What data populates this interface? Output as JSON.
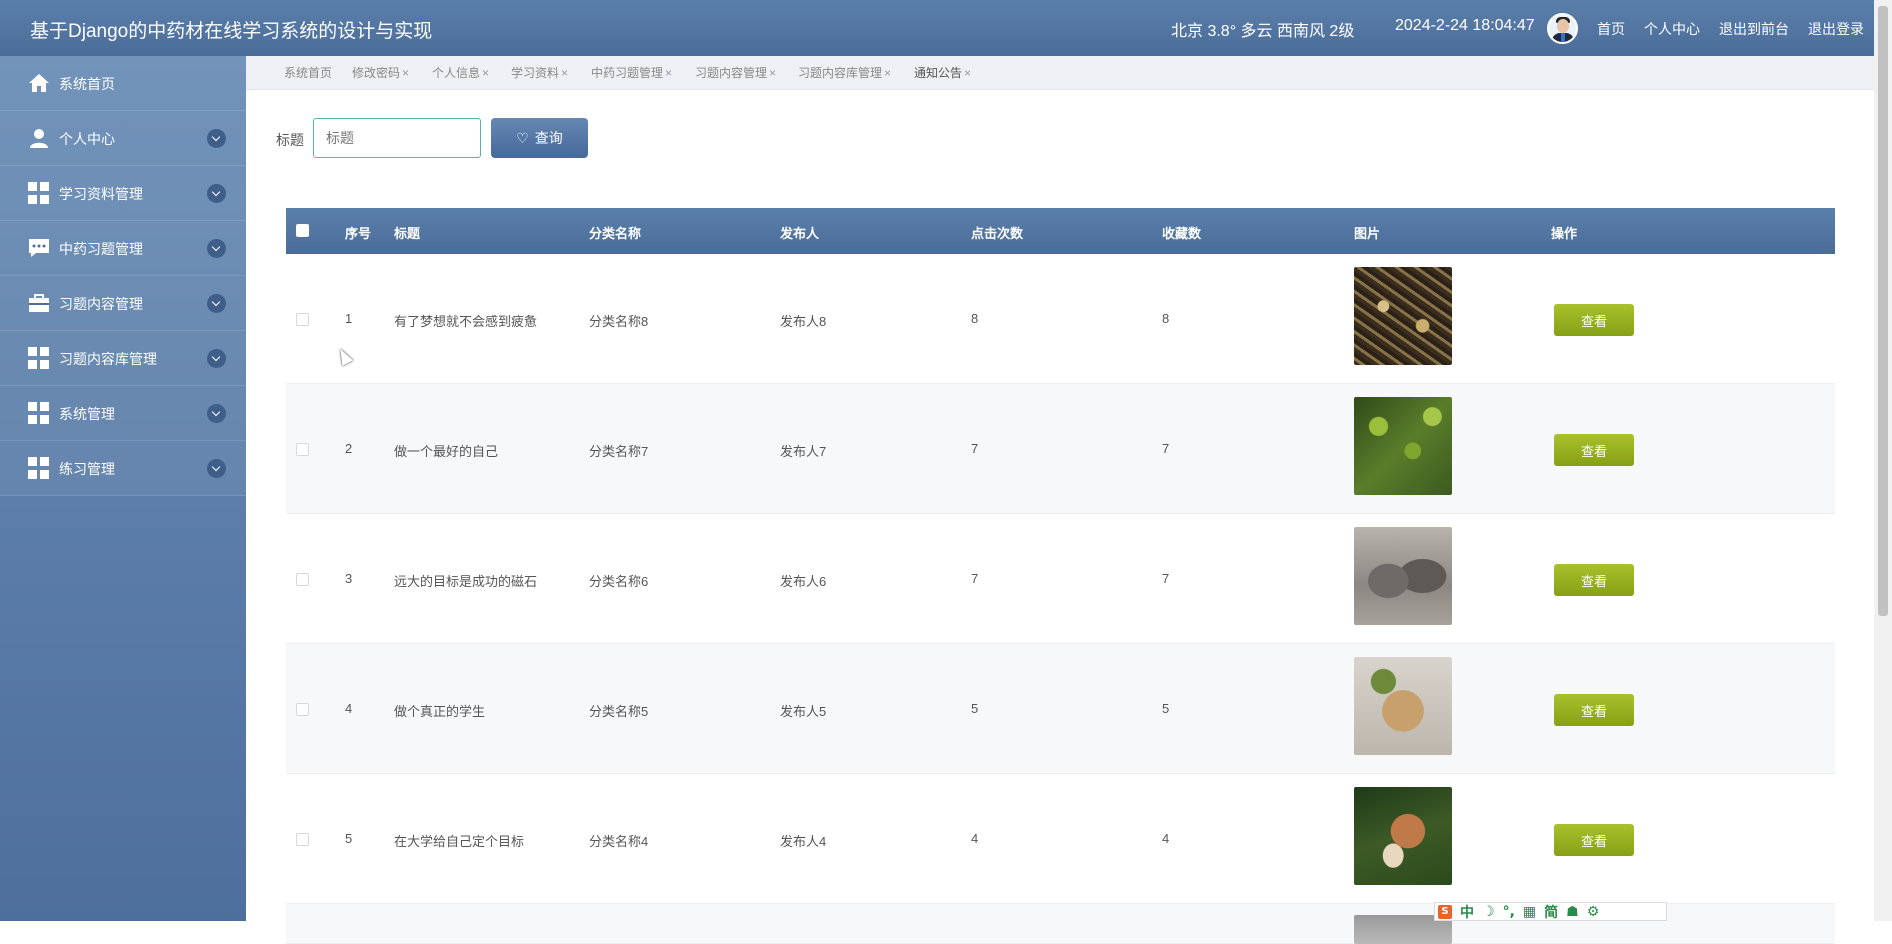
{
  "header": {
    "title": "基于Django的中药材在线学习系统的设计与实现",
    "weather": "北京  3.8°  多云  西南风  2级",
    "datetime": "2024-2-24 18:04:47",
    "links": [
      "首页",
      "个人中心",
      "退出到前台",
      "退出登录"
    ]
  },
  "sidebar": {
    "items": [
      {
        "label": "系统首页",
        "icon": "home-icon",
        "has_chevron": false
      },
      {
        "label": "个人中心",
        "icon": "user-icon",
        "has_chevron": true
      },
      {
        "label": "学习资料管理",
        "icon": "grid-icon",
        "has_chevron": true
      },
      {
        "label": "中药习题管理",
        "icon": "chat-icon",
        "has_chevron": true
      },
      {
        "label": "习题内容管理",
        "icon": "briefcase-icon",
        "has_chevron": true
      },
      {
        "label": "习题内容库管理",
        "icon": "grid-icon",
        "has_chevron": true
      },
      {
        "label": "系统管理",
        "icon": "grid-icon",
        "has_chevron": true
      },
      {
        "label": "练习管理",
        "icon": "grid-icon",
        "has_chevron": true
      }
    ]
  },
  "tabs": [
    {
      "label": "系统首页",
      "closable": false
    },
    {
      "label": "修改密码",
      "closable": true
    },
    {
      "label": "个人信息",
      "closable": true
    },
    {
      "label": "学习资料",
      "closable": true
    },
    {
      "label": "中药习题管理",
      "closable": true
    },
    {
      "label": "习题内容管理",
      "closable": true
    },
    {
      "label": "习题内容库管理",
      "closable": true
    },
    {
      "label": "通知公告",
      "closable": true,
      "active": true
    }
  ],
  "search": {
    "label": "标题",
    "placeholder": "标题",
    "button_label": "查询"
  },
  "table": {
    "columns": [
      "序号",
      "标题",
      "分类名称",
      "发布人",
      "点击次数",
      "收藏数",
      "图片",
      "操作"
    ],
    "action_label": "查看",
    "rows": [
      {
        "index": "1",
        "title": "有了梦想就不会感到疲惫",
        "category": "分类名称8",
        "publisher": "发布人8",
        "clicks": "8",
        "favorites": "8",
        "image": "dried-herb-roots"
      },
      {
        "index": "2",
        "title": "做一个最好的自己",
        "category": "分类名称7",
        "publisher": "发布人7",
        "clicks": "7",
        "favorites": "7",
        "image": "green-herb-plant"
      },
      {
        "index": "3",
        "title": "远大的目标是成功的磁石",
        "category": "分类名称6",
        "publisher": "发布人6",
        "clicks": "7",
        "favorites": "7",
        "image": "dried-lizards"
      },
      {
        "index": "4",
        "title": "做个真正的学生",
        "category": "分类名称5",
        "publisher": "发布人5",
        "clicks": "5",
        "favorites": "5",
        "image": "root-rhizome"
      },
      {
        "index": "5",
        "title": "在大学给自己定个目标",
        "category": "分类名称4",
        "publisher": "发布人4",
        "clicks": "4",
        "favorites": "4",
        "image": "mushroom"
      }
    ]
  },
  "ime": {
    "items": [
      "中",
      "☽",
      "°,",
      "▦",
      "简",
      "☗",
      "⚙"
    ]
  },
  "colors": {
    "header": "#4a6c98",
    "view_button": "#86a015",
    "search_border": "#5bb5a8"
  }
}
